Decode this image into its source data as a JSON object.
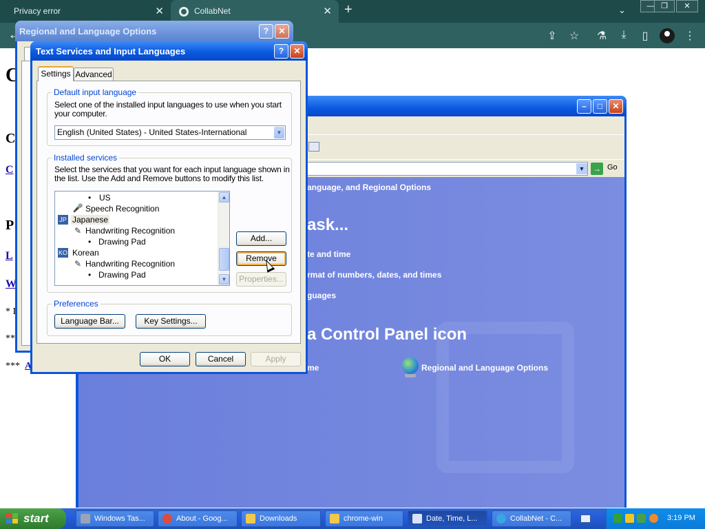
{
  "browser": {
    "tabs": [
      {
        "title": "Privacy error",
        "close": "✕"
      },
      {
        "title": "CollabNet",
        "close": "✕"
      }
    ],
    "new_tab": "+",
    "tab_menu": "⌄",
    "window_controls": [
      "—",
      "❐",
      "✕"
    ],
    "back": "←",
    "toolbar_icons": [
      "share-icon",
      "star-icon",
      "flask-icon",
      "download-icon",
      "sidebar-icon",
      "profile-icon",
      "menu-icon"
    ],
    "toolbar_glyphs": [
      "⇪",
      "☆",
      "⚗",
      "⤓",
      "▯",
      "",
      "⋮"
    ],
    "page_fragments": [
      "C",
      "C",
      "C",
      "P",
      "L",
      "W",
      "* I",
      "**",
      "***",
      "A"
    ]
  },
  "control_panel": {
    "go_label": "Go",
    "category_header": "anguage, and Regional Options",
    "pick_task": "ask...",
    "tasks": [
      "te and time",
      "rmat of numbers, dates, and times",
      "guages"
    ],
    "or_pick": "a Control Panel icon",
    "icons": [
      "me",
      "Regional and Language Options"
    ]
  },
  "regional_dialog": {
    "title": "Regional and Language Options",
    "help": "?",
    "close": "✕"
  },
  "text_services": {
    "title": "Text Services and Input Languages",
    "help": "?",
    "close": "✕",
    "tabs": [
      "Settings",
      "Advanced"
    ],
    "default_group": {
      "title": "Default input language",
      "desc": "Select one of the installed input languages to use when you start your computer.",
      "selected": "English (United States) - United States-International"
    },
    "installed_group": {
      "title": "Installed services",
      "desc": "Select the services that you want for each input language shown in the list. Use the Add and Remove buttons to modify this list.",
      "items": [
        {
          "type": "bullet",
          "label": "US"
        },
        {
          "type": "service",
          "label": "Speech Recognition"
        },
        {
          "type": "lang",
          "badge": "JP",
          "label": "Japanese"
        },
        {
          "type": "service",
          "label": "Handwriting Recognition"
        },
        {
          "type": "bullet",
          "label": "Drawing Pad"
        },
        {
          "type": "lang",
          "badge": "KO",
          "label": "Korean"
        },
        {
          "type": "service",
          "label": "Handwriting Recognition"
        },
        {
          "type": "bullet",
          "label": "Drawing Pad"
        }
      ],
      "buttons": {
        "add": "Add...",
        "remove": "Remove",
        "properties": "Properties..."
      }
    },
    "preferences_group": {
      "title": "Preferences",
      "language_bar": "Language Bar...",
      "key_settings": "Key Settings..."
    },
    "footer": {
      "ok": "OK",
      "cancel": "Cancel",
      "apply": "Apply"
    }
  },
  "taskbar": {
    "start": "start",
    "items": [
      {
        "label": "Windows Tas...",
        "color": "#9aa4b8"
      },
      {
        "label": "About - Goog...",
        "color": "#e04a3a"
      },
      {
        "label": "Downloads",
        "color": "#f2c94c"
      },
      {
        "label": "chrome-win",
        "color": "#f2c94c"
      },
      {
        "label": "Date, Time, L...",
        "color": "#d8e4f4"
      },
      {
        "label": "CollabNet - C...",
        "color": "#3aa5e0"
      }
    ],
    "clock": "3:19 PM"
  }
}
